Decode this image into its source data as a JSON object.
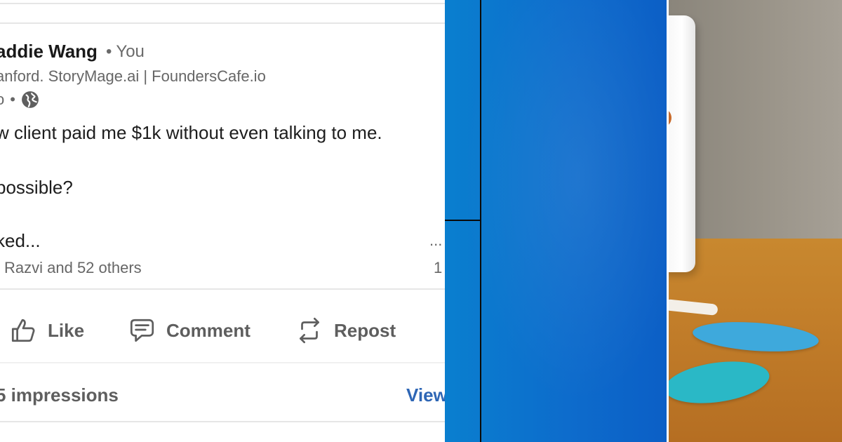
{
  "post": {
    "author_name": "addie Wang",
    "relationship": "You",
    "headline": "anford. StoryMage.ai | FoundersCafe.io",
    "time_ago": "o",
    "body_lines": [
      "w client paid me $1k without even talking to me.",
      " possible?",
      "ked..."
    ],
    "see_more": "...",
    "reactions_text": "Razvi and 52 others",
    "comment_count": "1",
    "actions": {
      "like": "Like",
      "comment": "Comment",
      "repost": "Repost"
    },
    "impressions": "5 impressions",
    "view_link": "View"
  },
  "colors": {
    "text_primary": "#191919",
    "text_secondary": "#666666",
    "action_text": "#5e5e5e",
    "link_blue": "#2e66b5",
    "panel_blue": "#0d6ccc"
  },
  "icons": {
    "globe": "globe-icon",
    "like": "thumbs-up-icon",
    "comment": "comment-bubble-icon",
    "repost": "repost-arrows-icon"
  }
}
